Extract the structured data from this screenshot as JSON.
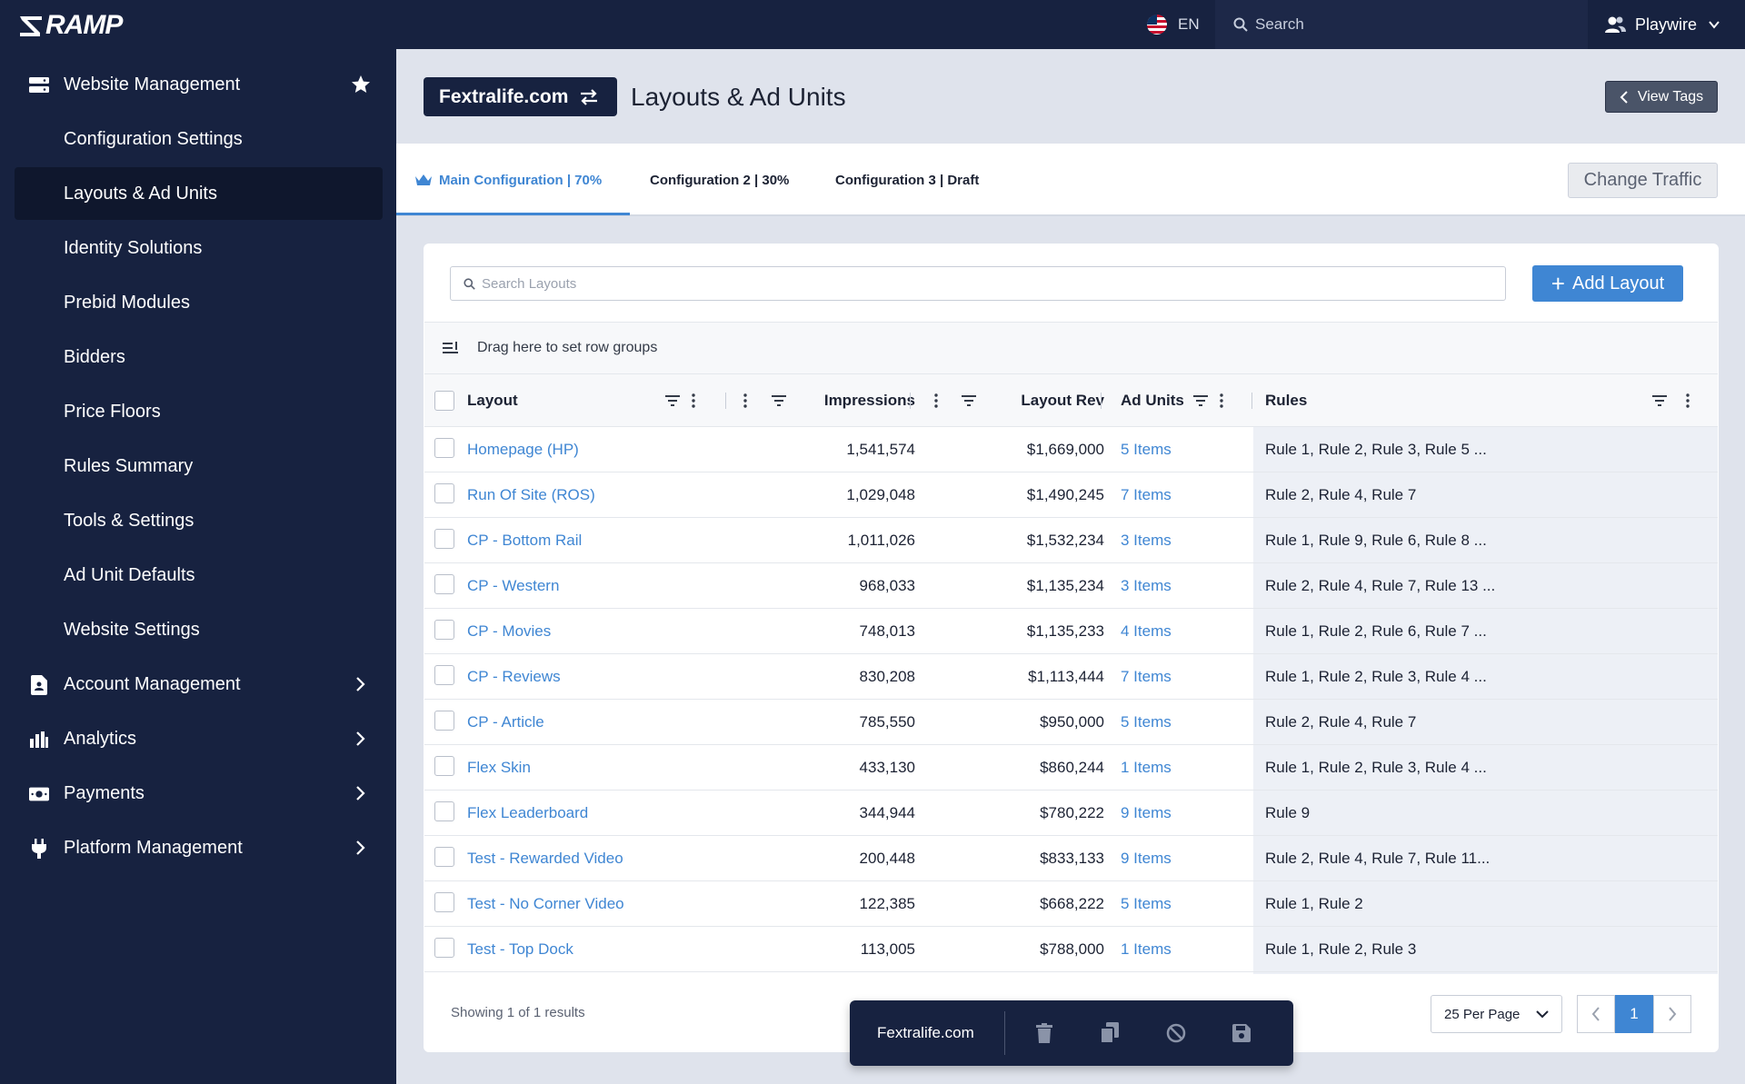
{
  "brand": {
    "name": "RAMP"
  },
  "topbar": {
    "language": "EN",
    "search_placeholder": "Search",
    "user": "Playwire"
  },
  "sidebar": {
    "section": {
      "label": "Website Management"
    },
    "sub_items": [
      {
        "label": "Configuration Settings"
      },
      {
        "label": "Layouts & Ad Units"
      },
      {
        "label": "Identity Solutions"
      },
      {
        "label": "Prebid Modules"
      },
      {
        "label": "Bidders"
      },
      {
        "label": "Price Floors"
      },
      {
        "label": "Rules Summary"
      },
      {
        "label": "Tools & Settings"
      },
      {
        "label": "Ad Unit Defaults"
      },
      {
        "label": "Website Settings"
      }
    ],
    "groups": [
      {
        "label": "Account Management",
        "icon": "document-icon"
      },
      {
        "label": "Analytics",
        "icon": "bar-chart-icon"
      },
      {
        "label": "Payments",
        "icon": "money-icon"
      },
      {
        "label": "Platform Management",
        "icon": "plug-icon"
      }
    ]
  },
  "header": {
    "site": "Fextralife.com",
    "title": "Layouts & Ad Units",
    "view_tags": "View Tags"
  },
  "tabs": [
    {
      "label": "Main Configuration | 70%"
    },
    {
      "label": "Configuration 2 | 30%"
    },
    {
      "label": "Configuration 3 | Draft"
    }
  ],
  "change_traffic": "Change Traffic",
  "search": {
    "placeholder": "Search Layouts"
  },
  "add_layout": "Add Layout",
  "group_bar": "Drag here to set row groups",
  "columns": {
    "layout": "Layout",
    "impressions": "Impressions",
    "layout_rev": "Layout Rev",
    "ad_units": "Ad Units",
    "rules": "Rules"
  },
  "rows": [
    {
      "layout": "Homepage (HP)",
      "impressions": "1,541,574",
      "rev": "$1,669,000",
      "ad_units": "5 Items",
      "rules": "Rule 1, Rule 2, Rule 3, Rule 5 ..."
    },
    {
      "layout": "Run Of Site (ROS)",
      "impressions": "1,029,048",
      "rev": "$1,490,245",
      "ad_units": "7 Items",
      "rules": "Rule 2, Rule 4, Rule 7"
    },
    {
      "layout": "CP - Bottom Rail",
      "impressions": "1,011,026",
      "rev": "$1,532,234",
      "ad_units": "3 Items",
      "rules": "Rule 1, Rule 9, Rule 6, Rule 8 ..."
    },
    {
      "layout": "CP - Western",
      "impressions": "968,033",
      "rev": "$1,135,234",
      "ad_units": "3 Items",
      "rules": "Rule 2, Rule 4, Rule 7, Rule 13 ..."
    },
    {
      "layout": "CP - Movies",
      "impressions": "748,013",
      "rev": "$1,135,233",
      "ad_units": "4 Items",
      "rules": "Rule 1, Rule 2, Rule 6, Rule 7 ..."
    },
    {
      "layout": "CP - Reviews",
      "impressions": "830,208",
      "rev": "$1,113,444",
      "ad_units": "7 Items",
      "rules": "Rule 1, Rule 2, Rule 3, Rule 4 ..."
    },
    {
      "layout": "CP - Article",
      "impressions": "785,550",
      "rev": "$950,000",
      "ad_units": "5 Items",
      "rules": "Rule 2, Rule 4, Rule 7"
    },
    {
      "layout": "Flex Skin",
      "impressions": "433,130",
      "rev": "$860,244",
      "ad_units": "1 Items",
      "rules": "Rule 1, Rule 2, Rule 3, Rule 4 ..."
    },
    {
      "layout": "Flex Leaderboard",
      "impressions": "344,944",
      "rev": "$780,222",
      "ad_units": "9 Items",
      "rules": "Rule 9"
    },
    {
      "layout": "Test - Rewarded Video",
      "impressions": "200,448",
      "rev": "$833,133",
      "ad_units": "9 Items",
      "rules": "Rule 2, Rule 4, Rule 7, Rule 11..."
    },
    {
      "layout": "Test - No Corner Video",
      "impressions": "122,385",
      "rev": "$668,222",
      "ad_units": "5 Items",
      "rules": "Rule 1, Rule 2"
    },
    {
      "layout": "Test - Top Dock",
      "impressions": "113,005",
      "rev": "$788,000",
      "ad_units": "1 Items",
      "rules": "Rule 1, Rule 2, Rule 3"
    }
  ],
  "footer": {
    "showing": "Showing 1 of 1 results",
    "per_page": "25 Per Page",
    "current_page": "1"
  },
  "floatbar": {
    "site": "Fextralife.com"
  },
  "colors": {
    "navy": "#172240",
    "accent": "#3f86d3"
  }
}
